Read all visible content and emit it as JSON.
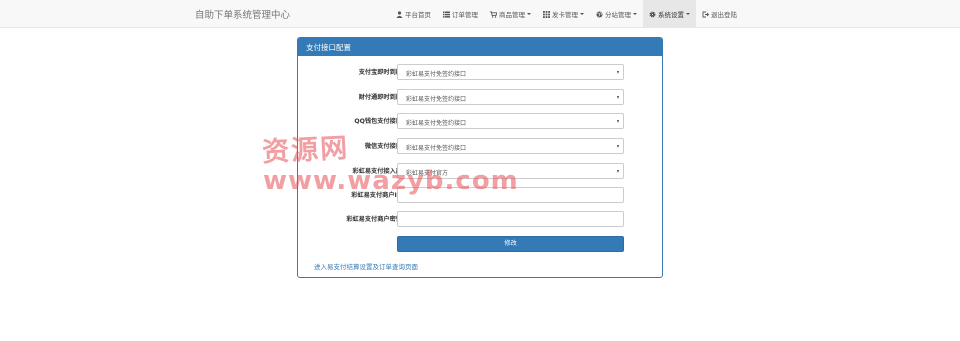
{
  "header": {
    "brand": "自助下单系统管理中心",
    "nav": [
      {
        "label": "平台首页",
        "icon": "user-icon",
        "dropdown": false,
        "active": false
      },
      {
        "label": "订单管理",
        "icon": "list-icon",
        "dropdown": false,
        "active": false
      },
      {
        "label": "商品管理",
        "icon": "shopping-cart-icon",
        "dropdown": true,
        "active": false
      },
      {
        "label": "发卡管理",
        "icon": "grid-icon",
        "dropdown": true,
        "active": false
      },
      {
        "label": "分站管理",
        "icon": "globe-icon",
        "dropdown": true,
        "active": false
      },
      {
        "label": "系统设置",
        "icon": "gear-icon",
        "dropdown": true,
        "active": true
      },
      {
        "label": "退出登陆",
        "icon": "logout-icon",
        "dropdown": false,
        "active": false
      }
    ]
  },
  "panel": {
    "title": "支付接口配置",
    "fields": [
      {
        "label": "支付宝即时到账",
        "type": "select",
        "value": "彩虹易支付免签约接口"
      },
      {
        "label": "财付通即时到账",
        "type": "select",
        "value": "彩虹易支付免签约接口"
      },
      {
        "label": "QQ钱包支付接口",
        "type": "select",
        "value": "彩虹易支付免签约接口"
      },
      {
        "label": "微信支付接口",
        "type": "select",
        "value": "彩虹易支付免签约接口"
      },
      {
        "label": "彩虹易支付接入商",
        "type": "select",
        "value": "彩虹易支付官方"
      },
      {
        "label": "彩虹易支付商户ID",
        "type": "input",
        "value": ""
      },
      {
        "label": "彩虹易支付商户密钥",
        "type": "input",
        "value": ""
      }
    ],
    "submit_label": "修改",
    "link_text": "进入易支付结算设置及订单查询页面"
  },
  "watermark": {
    "cn": "资源网",
    "url": "www.wazyb.com"
  },
  "colors": {
    "primary": "#337ab7",
    "navbar_bg": "#f8f8f8",
    "watermark": "#e8505a"
  }
}
